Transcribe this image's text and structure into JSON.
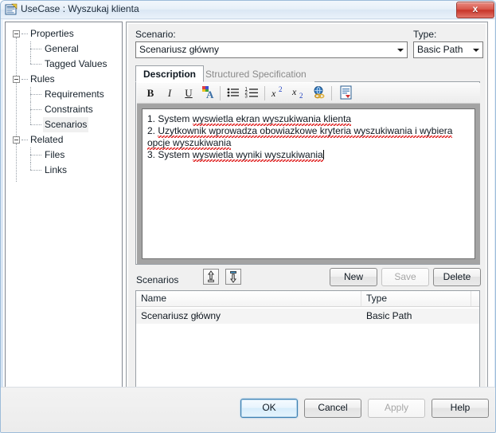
{
  "window": {
    "title": "UseCase : Wyszukaj klienta",
    "icon": "usecase-properties-icon",
    "close_label": "x"
  },
  "tree": {
    "nodes": [
      {
        "label": "Properties",
        "level": 0,
        "expanded": true,
        "selected": false
      },
      {
        "label": "General",
        "level": 1,
        "expanded": false,
        "selected": false
      },
      {
        "label": "Tagged Values",
        "level": 1,
        "expanded": false,
        "selected": false
      },
      {
        "label": "Rules",
        "level": 0,
        "expanded": true,
        "selected": false
      },
      {
        "label": "Requirements",
        "level": 1,
        "expanded": false,
        "selected": false
      },
      {
        "label": "Constraints",
        "level": 1,
        "expanded": false,
        "selected": false
      },
      {
        "label": "Scenarios",
        "level": 1,
        "expanded": false,
        "selected": true
      },
      {
        "label": "Related",
        "level": 0,
        "expanded": true,
        "selected": false
      },
      {
        "label": "Files",
        "level": 1,
        "expanded": false,
        "selected": false
      },
      {
        "label": "Links",
        "level": 1,
        "expanded": false,
        "selected": false
      }
    ]
  },
  "scenario": {
    "label": "Scenario:",
    "value": "Scenariusz główny"
  },
  "type": {
    "label": "Type:",
    "value": "Basic Path"
  },
  "tabs": [
    {
      "label": "Description",
      "active": true
    },
    {
      "label": "Structured Specification",
      "active": false
    }
  ],
  "editor_toolbar": {
    "buttons": [
      {
        "name": "bold-icon",
        "glyph": "B"
      },
      {
        "name": "italic-icon",
        "glyph": "I"
      },
      {
        "name": "underline-icon",
        "glyph": "U"
      },
      {
        "name": "font-color-icon",
        "glyph": "A"
      },
      {
        "name": "bullet-list-icon",
        "glyph": "☰"
      },
      {
        "name": "numbered-list-icon",
        "glyph": "≡"
      },
      {
        "name": "superscript-icon",
        "glyph": "x²"
      },
      {
        "name": "subscript-icon",
        "glyph": "x₂"
      },
      {
        "name": "hyperlink-icon",
        "glyph": "ἱ0"
      },
      {
        "name": "insert-template-icon",
        "glyph": "☷"
      }
    ]
  },
  "editor": {
    "lines": [
      {
        "prefix": "1. System ",
        "body": "wyswietla ekran wyszukiwania klienta"
      },
      {
        "prefix": "2. ",
        "body": "Uzytkownik wprowadza obowiazkowe kryteria wyszukiwania i wybiera opcje wyszukiwania"
      },
      {
        "prefix": "3. System ",
        "body": "wyswietla wyniki wyszukiwania"
      }
    ]
  },
  "scenarios_section": {
    "label": "Scenarios",
    "move_up_button": "move-up-icon",
    "move_down_button": "move-down-icon",
    "buttons": [
      {
        "label": "New",
        "disabled": false
      },
      {
        "label": "Save",
        "disabled": true
      },
      {
        "label": "Delete",
        "disabled": false
      }
    ]
  },
  "scenarios_list": {
    "columns": [
      "Name",
      "Type"
    ],
    "rows": [
      {
        "name": "Scenariusz główny",
        "type": "Basic Path",
        "selected": true
      }
    ]
  },
  "dialog_buttons": [
    {
      "label": "OK",
      "default": true,
      "disabled": false
    },
    {
      "label": "Cancel",
      "default": false,
      "disabled": false
    },
    {
      "label": "Apply",
      "default": false,
      "disabled": true
    },
    {
      "label": "Help",
      "default": false,
      "disabled": false
    }
  ],
  "colors": {
    "accent": "#3c7fb1",
    "close": "#c7352a",
    "spellcheck": "#e02020"
  }
}
